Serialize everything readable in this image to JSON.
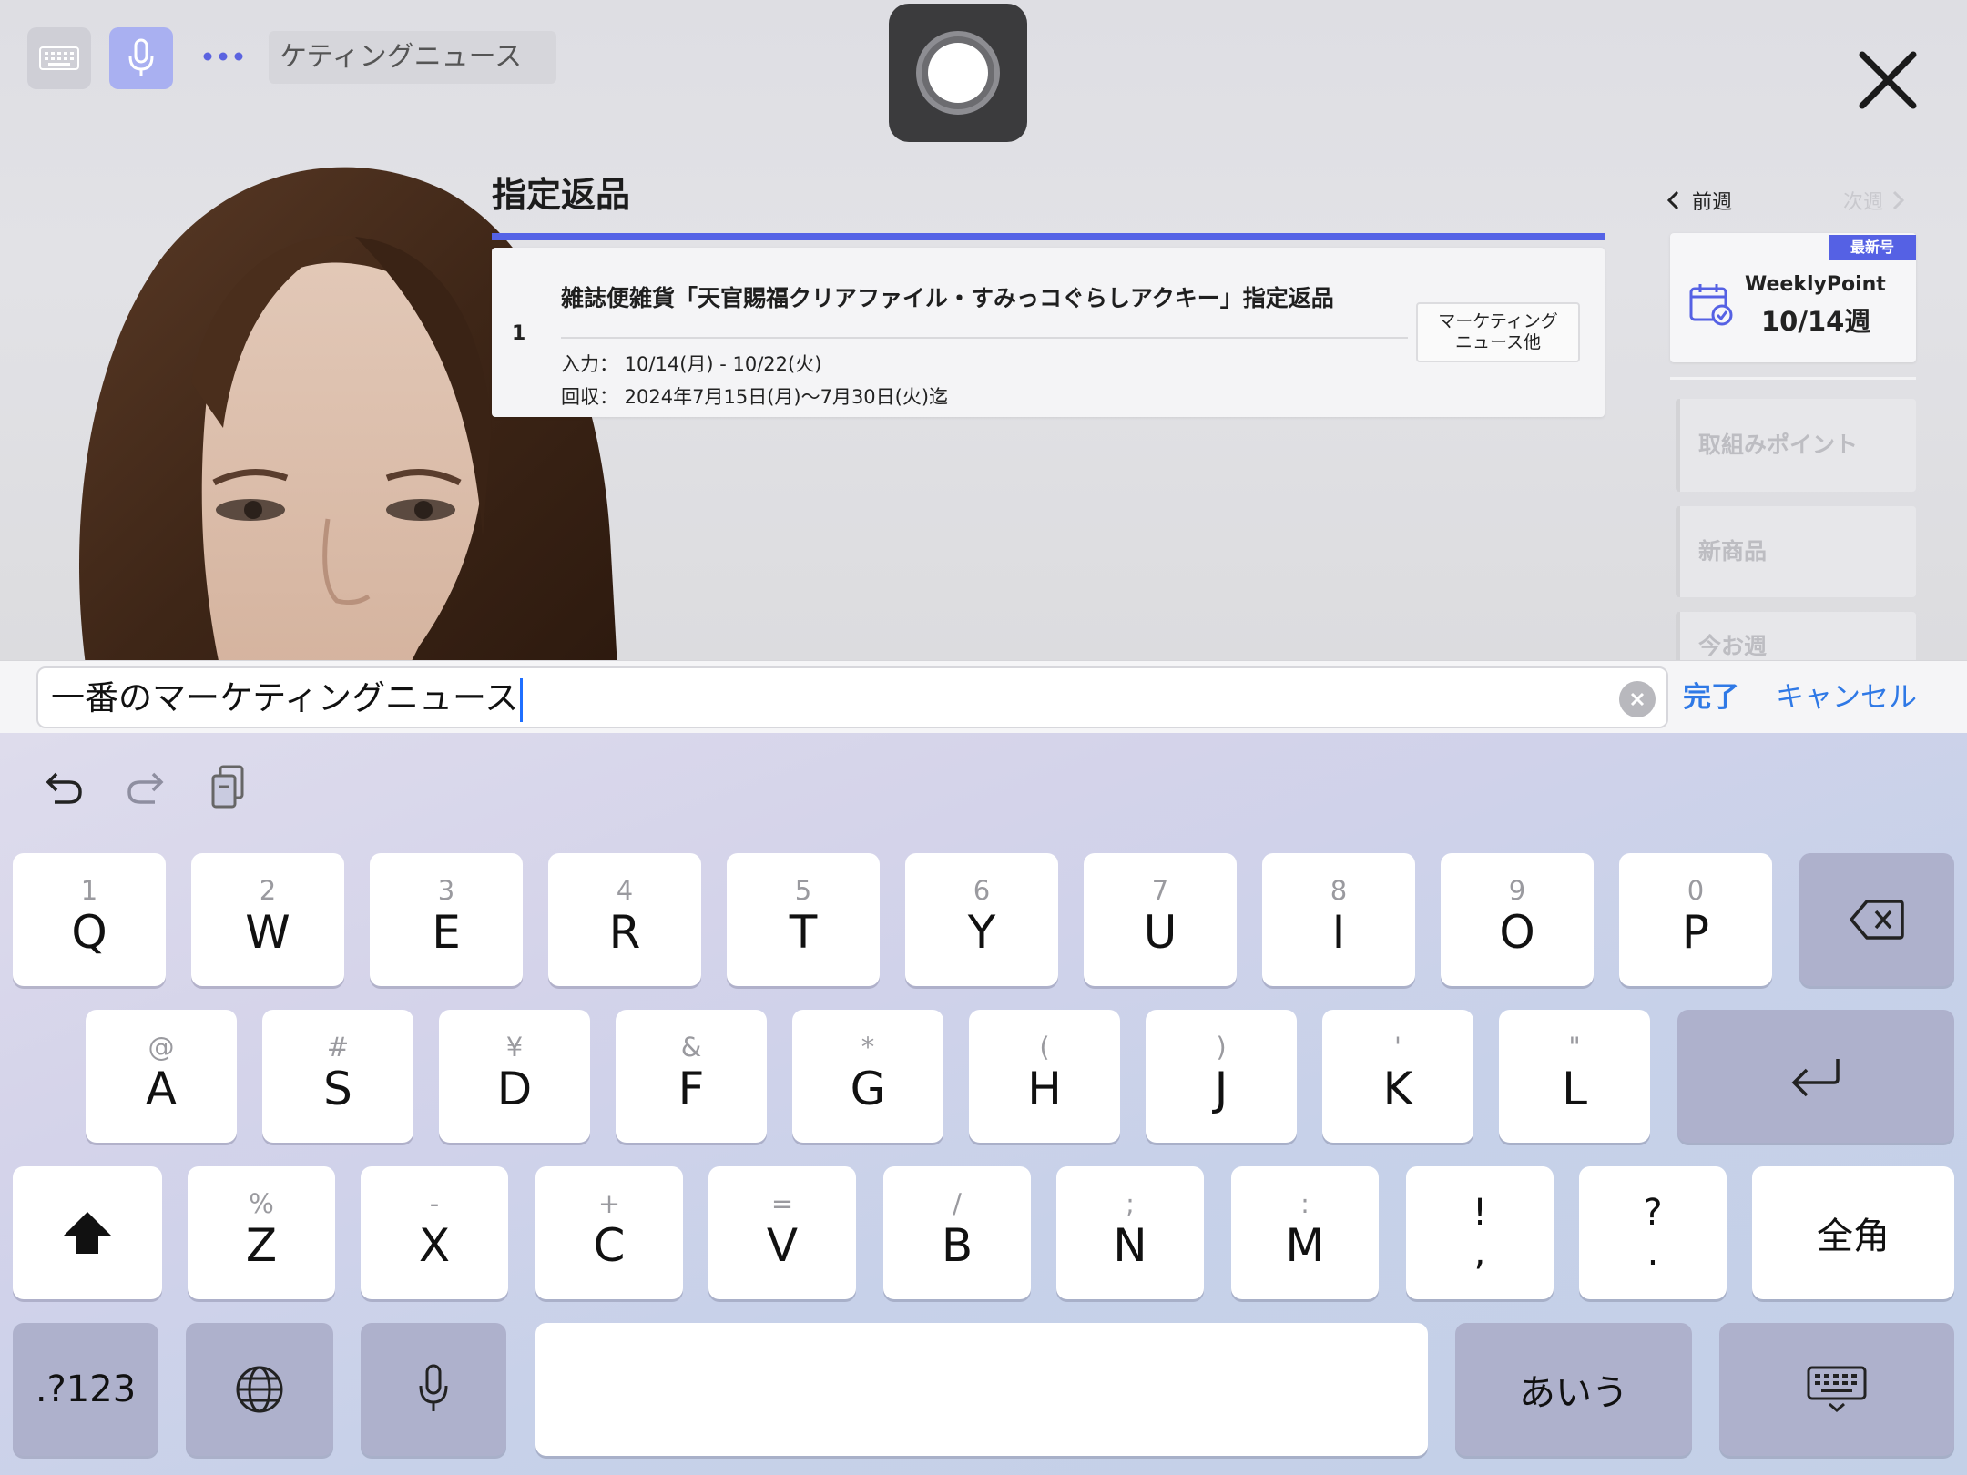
{
  "toolbar": {
    "preview_text": "ケティングニュース",
    "icons": {
      "keyboard": "keyboard-icon",
      "mic": "microphone-icon",
      "more": "more-dots-icon",
      "record": "record-icon",
      "close": "close-icon"
    }
  },
  "section": {
    "title": "指定返品"
  },
  "return_item": {
    "number": "1",
    "title": "雑誌便雑貨「天官賜福クリアファイル・すみっコぐらしアクキー」指定返品",
    "input_date": "入力： 10/14(月) - 10/22(火)",
    "collect_date": "回収： 2024年7月15日(月)〜7月30日(火)迄",
    "tag_line1": "マーケティング",
    "tag_line2": "ニュース他"
  },
  "week_nav": {
    "prev_label": "前週",
    "next_label": "次週"
  },
  "weekly_card": {
    "badge": "最新号",
    "name": "WeeklyPoint",
    "week": "10/14週",
    "accent": "#5561e4"
  },
  "side_menu": [
    {
      "label": "取組みポイント"
    },
    {
      "label": "新商品"
    },
    {
      "label": "今お週"
    }
  ],
  "input_bar": {
    "text": "一番のマーケティングニュース",
    "done_label": "完了",
    "cancel_label": "キャンセル",
    "link_color": "#2f79e6"
  },
  "keyboard": {
    "row1": [
      {
        "sub": "1",
        "main": "Q"
      },
      {
        "sub": "2",
        "main": "W"
      },
      {
        "sub": "3",
        "main": "E"
      },
      {
        "sub": "4",
        "main": "R"
      },
      {
        "sub": "5",
        "main": "T"
      },
      {
        "sub": "6",
        "main": "Y"
      },
      {
        "sub": "7",
        "main": "U"
      },
      {
        "sub": "8",
        "main": "I"
      },
      {
        "sub": "9",
        "main": "O"
      },
      {
        "sub": "0",
        "main": "P"
      }
    ],
    "row2": [
      {
        "sub": "@",
        "main": "A"
      },
      {
        "sub": "#",
        "main": "S"
      },
      {
        "sub": "¥",
        "main": "D"
      },
      {
        "sub": "&",
        "main": "F"
      },
      {
        "sub": "*",
        "main": "G"
      },
      {
        "sub": "(",
        "main": "H"
      },
      {
        "sub": ")",
        "main": "J"
      },
      {
        "sub": "'",
        "main": "K"
      },
      {
        "sub": "\"",
        "main": "L"
      }
    ],
    "row3": [
      {
        "sub": "%",
        "main": "Z"
      },
      {
        "sub": "-",
        "main": "X"
      },
      {
        "sub": "+",
        "main": "C"
      },
      {
        "sub": "=",
        "main": "V"
      },
      {
        "sub": "/",
        "main": "B"
      },
      {
        "sub": ";",
        "main": "N"
      },
      {
        "sub": ":",
        "main": "M"
      }
    ],
    "punct1": {
      "top": "!",
      "bottom": ","
    },
    "punct2": {
      "top": "?",
      "bottom": "."
    },
    "zenkaku_label": "全角",
    "numbers_label": ".?123",
    "kana_label": "あいう"
  }
}
